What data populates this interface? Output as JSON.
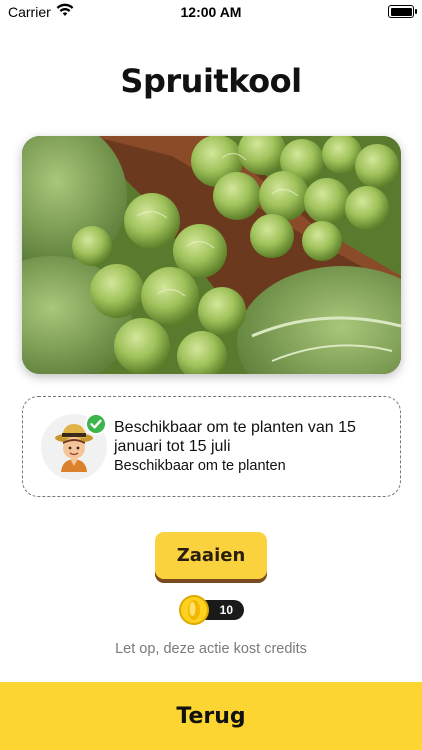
{
  "status_bar": {
    "carrier": "Carrier",
    "time": "12:00 AM",
    "wifi_icon": "wifi-icon",
    "battery_icon": "battery-icon"
  },
  "page": {
    "title": "Spruitkool"
  },
  "availability": {
    "headline": "Beschikbaar om te planten van 15 januari tot 15 juli",
    "subtext": "Beschikbaar om te planten",
    "avatar_icon": "farmer-avatar-icon",
    "status_icon": "checkmark-icon"
  },
  "actions": {
    "sow_label": "Zaaien",
    "credit_cost": "10",
    "coin_icon": "coin-icon",
    "notice": "Let op, deze actie kost credits",
    "back_label": "Terug"
  },
  "colors": {
    "accent_yellow": "#fcd533",
    "button_yellow": "#f9d23d",
    "button_shadow": "#7a4a1e",
    "success_green": "#3cb54a"
  }
}
